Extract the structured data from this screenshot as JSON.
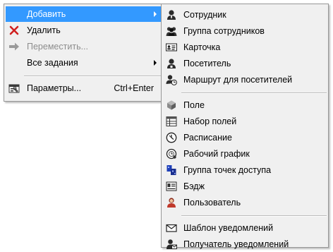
{
  "context_menu": {
    "items": [
      {
        "label": "Добавить",
        "has_submenu": true,
        "selected": true
      },
      {
        "label": "Удалить",
        "icon": "delete-x-icon"
      },
      {
        "label": "Переместить...",
        "icon": "move-arrow-icon",
        "disabled": true
      },
      {
        "label": "Все задания",
        "has_submenu": true
      },
      {
        "label": "Параметры...",
        "shortcut": "Ctrl+Enter",
        "icon": "properties-icon"
      }
    ]
  },
  "add_submenu": {
    "items": [
      {
        "label": "Сотрудник",
        "icon": "employee-icon"
      },
      {
        "label": "Группа сотрудников",
        "icon": "employee-group-icon"
      },
      {
        "label": "Карточка",
        "icon": "card-icon"
      },
      {
        "label": "Посетитель",
        "icon": "visitor-icon"
      },
      {
        "label": "Маршрут для посетителей",
        "icon": "visitor-route-icon"
      },
      {
        "label": "Поле",
        "icon": "field-icon"
      },
      {
        "label": "Набор полей",
        "icon": "field-set-icon"
      },
      {
        "label": "Расписание",
        "icon": "schedule-clock-icon"
      },
      {
        "label": "Рабочий график",
        "icon": "work-schedule-icon"
      },
      {
        "label": "Группа точек доступа",
        "icon": "access-point-group-icon"
      },
      {
        "label": "Бэдж",
        "icon": "badge-icon"
      },
      {
        "label": "Пользователь",
        "icon": "user-icon"
      },
      {
        "label": "Шаблон уведомлений",
        "icon": "notification-template-icon"
      },
      {
        "label": "Получатель уведомлений",
        "icon": "notification-recipient-icon"
      }
    ]
  },
  "colors": {
    "menu_background": "#f0f0f0",
    "selection": "#3399ff",
    "disabled_text": "#8d8d8d",
    "delete_red": "#d02020"
  }
}
